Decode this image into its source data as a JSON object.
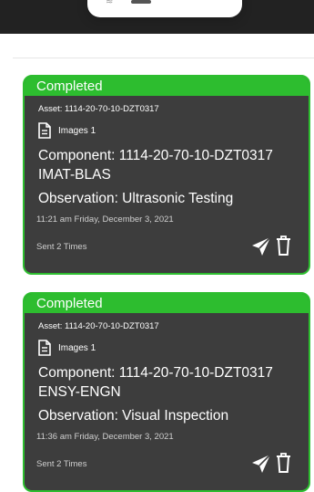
{
  "cards": [
    {
      "status": "Completed",
      "asset": "Asset: 1114-20-70-10-DZT0317",
      "images": "Images  1",
      "component_line1": "Component: 1114-20-70-10-DZT0317",
      "component_line2": "IMAT-BLAS",
      "observation": "Observation: Ultrasonic Testing",
      "time": "11:21 am Friday, December 3, 2021",
      "sent": "Sent 2 Times"
    },
    {
      "status": "Completed",
      "asset": "Asset: 1114-20-70-10-DZT0317",
      "images": "Images  1",
      "component_line1": "Component: 1114-20-70-10-DZT0317",
      "component_line2": "ENSY-ENGN",
      "observation": "Observation: Visual Inspection",
      "time": "11:36 am Friday, December 3, 2021",
      "sent": "Sent 2 Times"
    }
  ],
  "colors": {
    "status_green": "#2dbd2f",
    "card_background": "#3d3d3d",
    "top_bar": "#222222"
  },
  "icons": [
    "document-icon",
    "send-icon",
    "trash-icon"
  ]
}
